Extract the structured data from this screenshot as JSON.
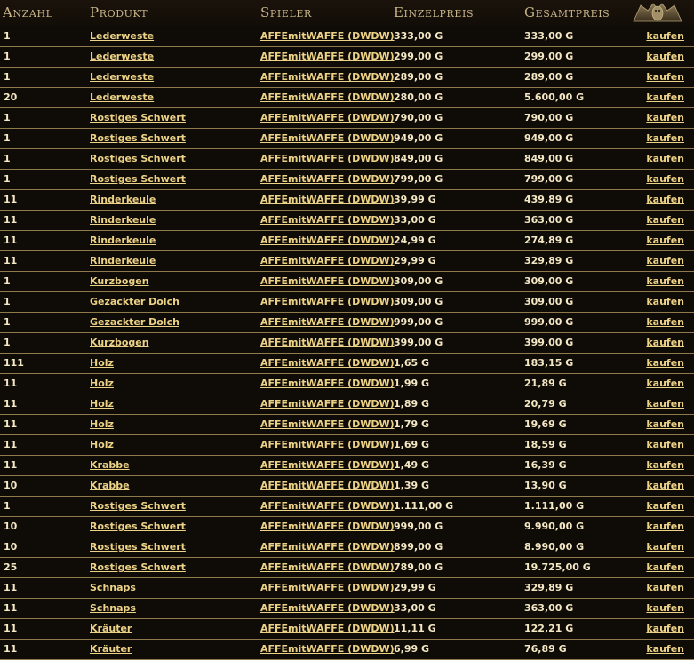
{
  "columns": {
    "qty": "Anzahl",
    "product": "Produkt",
    "player": "Spieler",
    "unit_price": "Einzelpreis",
    "total_price": "Gesamtpreis"
  },
  "buy_label": "kaufen",
  "icons": {
    "header_emblem": "gargoyle-emblem-icon"
  },
  "colors": {
    "background": "#0f0b07",
    "link": "#ecd286",
    "header_text": "#c9b58a",
    "divider": "#8f7a4e"
  },
  "rows": [
    {
      "qty": "1",
      "product": "Lederweste",
      "player": "AFFEmitWAFFE (DWDW)",
      "unit": "333,00 G",
      "total": "333,00 G"
    },
    {
      "qty": "1",
      "product": "Lederweste",
      "player": "AFFEmitWAFFE (DWDW)",
      "unit": "299,00 G",
      "total": "299,00 G"
    },
    {
      "qty": "1",
      "product": "Lederweste",
      "player": "AFFEmitWAFFE (DWDW)",
      "unit": "289,00 G",
      "total": "289,00 G"
    },
    {
      "qty": "20",
      "product": "Lederweste",
      "player": "AFFEmitWAFFE (DWDW)",
      "unit": "280,00 G",
      "total": "5.600,00 G"
    },
    {
      "qty": "1",
      "product": "Rostiges Schwert",
      "player": "AFFEmitWAFFE (DWDW)",
      "unit": "790,00 G",
      "total": "790,00 G"
    },
    {
      "qty": "1",
      "product": "Rostiges Schwert",
      "player": "AFFEmitWAFFE (DWDW)",
      "unit": "949,00 G",
      "total": "949,00 G"
    },
    {
      "qty": "1",
      "product": "Rostiges Schwert",
      "player": "AFFEmitWAFFE (DWDW)",
      "unit": "849,00 G",
      "total": "849,00 G"
    },
    {
      "qty": "1",
      "product": "Rostiges Schwert",
      "player": "AFFEmitWAFFE (DWDW)",
      "unit": "799,00 G",
      "total": "799,00 G"
    },
    {
      "qty": "11",
      "product": "Rinderkeule",
      "player": "AFFEmitWAFFE (DWDW)",
      "unit": "39,99 G",
      "total": "439,89 G"
    },
    {
      "qty": "11",
      "product": "Rinderkeule",
      "player": "AFFEmitWAFFE (DWDW)",
      "unit": "33,00 G",
      "total": "363,00 G"
    },
    {
      "qty": "11",
      "product": "Rinderkeule",
      "player": "AFFEmitWAFFE (DWDW)",
      "unit": "24,99 G",
      "total": "274,89 G"
    },
    {
      "qty": "11",
      "product": "Rinderkeule",
      "player": "AFFEmitWAFFE (DWDW)",
      "unit": "29,99 G",
      "total": "329,89 G"
    },
    {
      "qty": "1",
      "product": "Kurzbogen",
      "player": "AFFEmitWAFFE (DWDW)",
      "unit": "309,00 G",
      "total": "309,00 G"
    },
    {
      "qty": "1",
      "product": "Gezackter Dolch",
      "player": "AFFEmitWAFFE (DWDW)",
      "unit": "309,00 G",
      "total": "309,00 G"
    },
    {
      "qty": "1",
      "product": "Gezackter Dolch",
      "player": "AFFEmitWAFFE (DWDW)",
      "unit": "999,00 G",
      "total": "999,00 G"
    },
    {
      "qty": "1",
      "product": "Kurzbogen",
      "player": "AFFEmitWAFFE (DWDW)",
      "unit": "399,00 G",
      "total": "399,00 G"
    },
    {
      "qty": "111",
      "product": "Holz",
      "player": "AFFEmitWAFFE (DWDW)",
      "unit": "1,65 G",
      "total": "183,15 G"
    },
    {
      "qty": "11",
      "product": "Holz",
      "player": "AFFEmitWAFFE (DWDW)",
      "unit": "1,99 G",
      "total": "21,89 G"
    },
    {
      "qty": "11",
      "product": "Holz",
      "player": "AFFEmitWAFFE (DWDW)",
      "unit": "1,89 G",
      "total": "20,79 G"
    },
    {
      "qty": "11",
      "product": "Holz",
      "player": "AFFEmitWAFFE (DWDW)",
      "unit": "1,79 G",
      "total": "19,69 G"
    },
    {
      "qty": "11",
      "product": "Holz",
      "player": "AFFEmitWAFFE (DWDW)",
      "unit": "1,69 G",
      "total": "18,59 G"
    },
    {
      "qty": "11",
      "product": "Krabbe",
      "player": "AFFEmitWAFFE (DWDW)",
      "unit": "1,49 G",
      "total": "16,39 G"
    },
    {
      "qty": "10",
      "product": "Krabbe",
      "player": "AFFEmitWAFFE (DWDW)",
      "unit": "1,39 G",
      "total": "13,90 G"
    },
    {
      "qty": "1",
      "product": "Rostiges Schwert",
      "player": "AFFEmitWAFFE (DWDW)",
      "unit": "1.111,00 G",
      "total": "1.111,00 G"
    },
    {
      "qty": "10",
      "product": "Rostiges Schwert",
      "player": "AFFEmitWAFFE (DWDW)",
      "unit": "999,00 G",
      "total": "9.990,00 G"
    },
    {
      "qty": "10",
      "product": "Rostiges Schwert",
      "player": "AFFEmitWAFFE (DWDW)",
      "unit": "899,00 G",
      "total": "8.990,00 G"
    },
    {
      "qty": "25",
      "product": "Rostiges Schwert",
      "player": "AFFEmitWAFFE (DWDW)",
      "unit": "789,00 G",
      "total": "19.725,00 G"
    },
    {
      "qty": "11",
      "product": "Schnaps",
      "player": "AFFEmitWAFFE (DWDW)",
      "unit": "29,99 G",
      "total": "329,89 G"
    },
    {
      "qty": "11",
      "product": "Schnaps",
      "player": "AFFEmitWAFFE (DWDW)",
      "unit": "33,00 G",
      "total": "363,00 G"
    },
    {
      "qty": "11",
      "product": "Kräuter",
      "player": "AFFEmitWAFFE (DWDW)",
      "unit": "11,11 G",
      "total": "122,21 G"
    },
    {
      "qty": "11",
      "product": "Kräuter",
      "player": "AFFEmitWAFFE (DWDW)",
      "unit": "6,99 G",
      "total": "76,89 G"
    }
  ]
}
